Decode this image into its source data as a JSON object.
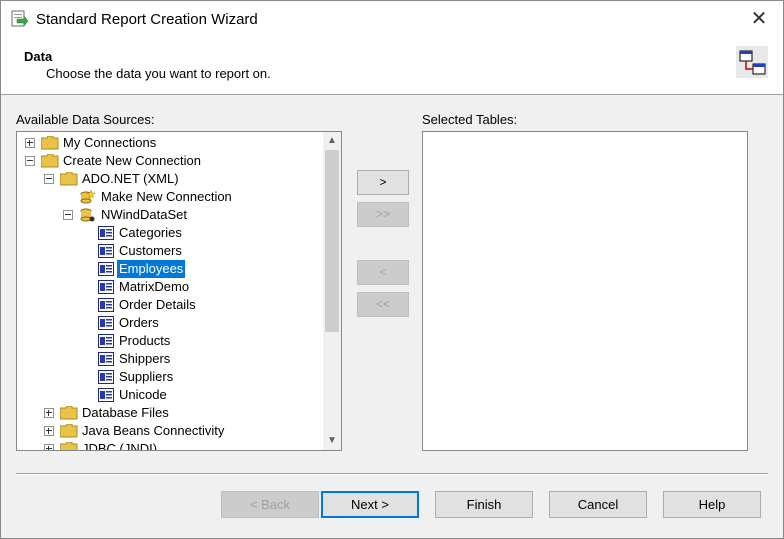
{
  "window": {
    "title": "Standard Report Creation Wizard"
  },
  "header": {
    "title": "Data",
    "subtitle": "Choose the data you want to report on."
  },
  "available": {
    "label": "Available Data Sources:",
    "nodes": [
      {
        "label": "My Connections"
      },
      {
        "label": "Create New Connection"
      },
      {
        "label": "ADO.NET (XML)"
      },
      {
        "label": "Make New Connection"
      },
      {
        "label": "NWindDataSet"
      },
      {
        "label": "Categories"
      },
      {
        "label": "Customers"
      },
      {
        "label": "Employees"
      },
      {
        "label": "MatrixDemo"
      },
      {
        "label": "Order Details"
      },
      {
        "label": "Orders"
      },
      {
        "label": "Products"
      },
      {
        "label": "Shippers"
      },
      {
        "label": "Suppliers"
      },
      {
        "label": "Unicode"
      },
      {
        "label": "Database Files"
      },
      {
        "label": "Java Beans Connectivity"
      },
      {
        "label": "JDBC (JNDI)"
      }
    ],
    "selected": "Employees"
  },
  "selected_tables": {
    "label": "Selected Tables:",
    "items": []
  },
  "move": {
    "add": ">",
    "add_all": ">>",
    "remove": "<",
    "remove_all": "<<"
  },
  "buttons": {
    "back": "< Back",
    "next": "Next >",
    "finish": "Finish",
    "cancel": "Cancel",
    "help": "Help"
  },
  "colors": {
    "selection": "#0078d7",
    "default_border": "#0078d7",
    "folder": "#e8c24a"
  }
}
